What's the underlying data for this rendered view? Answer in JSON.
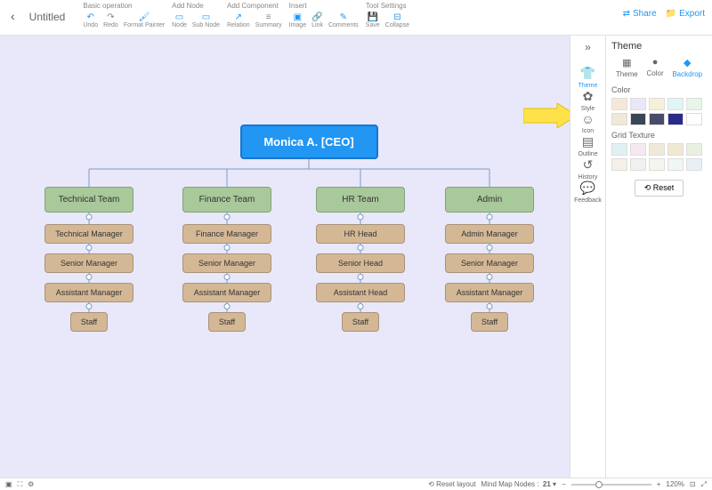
{
  "header": {
    "title": "Untitled",
    "groups": [
      {
        "label": "Basic operation",
        "items": [
          {
            "name": "undo",
            "label": "Undo",
            "glyph": "↶",
            "blue": true
          },
          {
            "name": "redo",
            "label": "Redo",
            "glyph": "↷"
          },
          {
            "name": "format-painter",
            "label": "Format Painter",
            "glyph": "🖌",
            "blue": true
          }
        ]
      },
      {
        "label": "Add Node",
        "items": [
          {
            "name": "node",
            "label": "Node",
            "glyph": "▭",
            "blue": true
          },
          {
            "name": "sub-node",
            "label": "Sub Node",
            "glyph": "▭",
            "blue": true
          }
        ]
      },
      {
        "label": "Add Component",
        "items": [
          {
            "name": "relation",
            "label": "Relation",
            "glyph": "↗",
            "blue": true
          },
          {
            "name": "summary",
            "label": "Summary",
            "glyph": "≡"
          }
        ]
      },
      {
        "label": "Insert",
        "items": [
          {
            "name": "image",
            "label": "Image",
            "glyph": "▣",
            "blue": true
          },
          {
            "name": "link",
            "label": "Link",
            "glyph": "🔗",
            "blue": true
          },
          {
            "name": "comments",
            "label": "Comments",
            "glyph": "✎",
            "blue": true
          }
        ]
      },
      {
        "label": "Tool Settings",
        "items": [
          {
            "name": "save",
            "label": "Save",
            "glyph": "💾"
          },
          {
            "name": "collapse",
            "label": "Collapse",
            "glyph": "⊟",
            "blue": true
          }
        ]
      }
    ],
    "share": "Share",
    "export": "Export"
  },
  "sideIcons": [
    {
      "name": "theme",
      "label": "Theme",
      "glyph": "👕",
      "active": true
    },
    {
      "name": "style",
      "label": "Style",
      "glyph": "✿"
    },
    {
      "name": "icon",
      "label": "Icon",
      "glyph": "☺"
    },
    {
      "name": "outline",
      "label": "Outline",
      "glyph": "▤"
    },
    {
      "name": "history",
      "label": "History",
      "glyph": "↺"
    },
    {
      "name": "feedback",
      "label": "Feedback",
      "glyph": "💬"
    }
  ],
  "panel": {
    "header": "Theme",
    "tabs": [
      {
        "name": "theme",
        "label": "Theme",
        "glyph": "▦"
      },
      {
        "name": "color",
        "label": "Color",
        "glyph": "●"
      },
      {
        "name": "backdrop",
        "label": "Backdrop",
        "glyph": "◆",
        "active": true
      }
    ],
    "color_label": "Color",
    "color_swatches": [
      "#f5e8d8",
      "#e8e8fa",
      "#f5f0d8",
      "#e0f5f5",
      "#e8f5e8",
      "#f0e8d8",
      "#3a4556",
      "#4a4a6a",
      "#2a2a8a",
      "#ffffff"
    ],
    "grid_label": "Grid Texture",
    "grid_swatches": [
      "#e0f0f5",
      "#f5e8f0",
      "#f0e8d8",
      "#f0e8d0",
      "#e8f0e0",
      "#f5f0e8",
      "#f0f0f0",
      "#f5f5f0",
      "#f0f5f5",
      "#e8f0f5"
    ],
    "reset": "Reset"
  },
  "chart_data": {
    "type": "org",
    "root": {
      "label": "Monica A. [CEO]"
    },
    "branches": [
      {
        "team": "Technical Team",
        "chain": [
          "Technical Manager",
          "Senior Manager",
          "Assistant Manager",
          "Staff"
        ]
      },
      {
        "team": "Finance Team",
        "chain": [
          "Finance Manager",
          "Senior Manager",
          "Assistant Manager",
          "Staff"
        ]
      },
      {
        "team": "HR Team",
        "chain": [
          "HR Head",
          "Senior Head",
          "Assistant Head",
          "Staff"
        ]
      },
      {
        "team": "Admin",
        "chain": [
          "Admin Manager",
          "Senior Manager",
          "Assistant Manager",
          "Staff"
        ]
      }
    ]
  },
  "status": {
    "reset_layout": "Reset layout",
    "nodes_label": "Mind Map Nodes :",
    "nodes_count": "21",
    "zoom": "120%"
  }
}
